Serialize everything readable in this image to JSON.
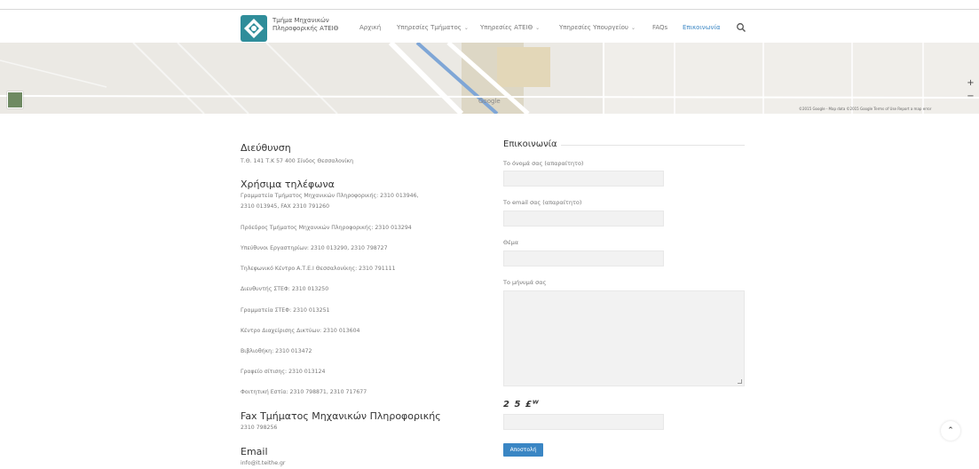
{
  "header": {
    "logo_line1": "Τμήμα Μηχανικών",
    "logo_line2": "Πληροφορικής ΑΤΕΙΘ",
    "nav": [
      {
        "label": "Αρχική",
        "dropdown": false,
        "active": false
      },
      {
        "label": "Υπηρεσίες Τμήματος",
        "dropdown": true,
        "active": false
      },
      {
        "label": "Υπηρεσίες ΑΤΕΙΘ",
        "dropdown": true,
        "active": false
      },
      {
        "label": "Υπηρεσίες Υπουργείου",
        "dropdown": true,
        "active": false
      },
      {
        "label": "FAQs",
        "dropdown": false,
        "active": false
      },
      {
        "label": "Επικοινωνία",
        "dropdown": false,
        "active": true
      }
    ],
    "search_icon": "search-icon"
  },
  "map": {
    "google_label": "Google",
    "attribution": "©2015 Google - Map data ©2015 Google   Terms of Use   Report a map error",
    "zoom_in": "+",
    "zoom_out": "−"
  },
  "contact_info": {
    "address_heading": "Διεύθυνση",
    "address_text": "Τ.Θ. 141 Τ.Κ 57 400 Σίνδος Θεσσαλονίκη",
    "phones_heading": "Χρήσιμα τηλέφωνα",
    "phones": [
      "Γραμματεία Τμήματος Μηχανικών Πληροφορικής: 2310 013946,",
      "2310 013945, FAX 2310 791260",
      "Πρόεδρος Τμήματος Μηχανικών Πληροφορικής: 2310 013294",
      "Υπεύθυνοι Εργαστηρίων: 2310 013290, 2310 798727",
      "Τηλεφωνικό Κέντρο Α.Τ.Ε.Ι Θεσσαλονίκης: 2310 791111",
      "Διευθυντής ΣΤΕΦ: 2310 013250",
      "Γραμματεία ΣΤΕΦ: 2310 013251",
      "Κέντρο Διαχείρισης Δικτύων: 2310 013604",
      "Βιβλιοθήκη: 2310 013472",
      "Γραφείο σίτισης: 2310 013124",
      "Φοιτητική Εστία: 2310 798871, 2310 717677"
    ],
    "fax_heading": "Fax Τμήματος Μηχανικών Πληροφορικής",
    "fax_text": "2310 798256",
    "email_heading": "Email",
    "email_text": "info@it.teithe.gr"
  },
  "form": {
    "title": "Επικοινωνία",
    "name_label": "Το όνομά σας (απαραίτητο)",
    "email_label": "Το email σας (απαραίτητο)",
    "subject_label": "Θέμα",
    "message_label": "Το μήνυμά σας",
    "captcha_text": "2 5 £ᵂ",
    "submit_label": "Αποστολή"
  },
  "back_to_top": "⌃"
}
